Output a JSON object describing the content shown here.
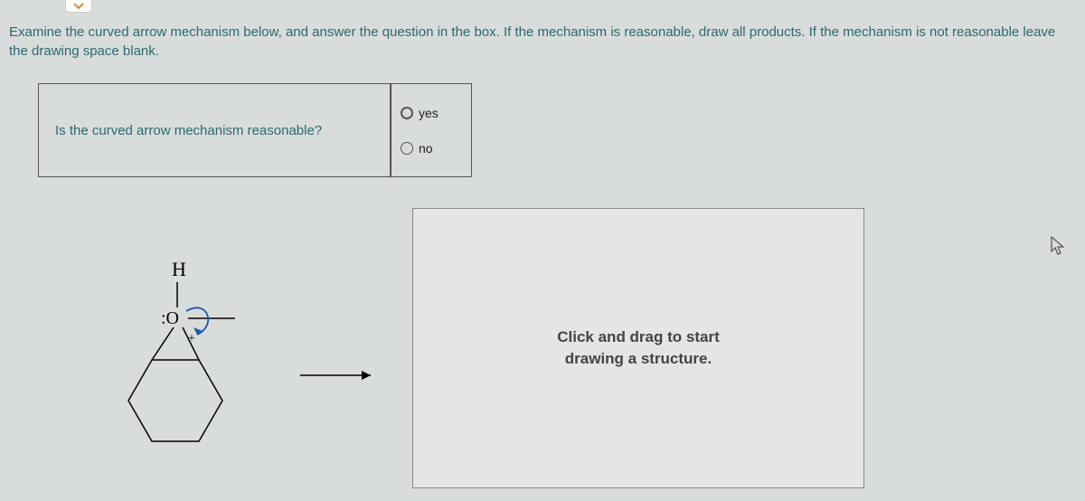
{
  "instruction": "Examine the curved arrow mechanism below, and answer the question in the box. If the mechanism is reasonable, draw all products. If the mechanism is not reasonable leave the drawing space blank.",
  "question": "Is the curved arrow mechanism reasonable?",
  "options": {
    "yes": "yes",
    "no": "no"
  },
  "molecule": {
    "h_label": "H",
    "o_label": ":O",
    "plus_label": "+"
  },
  "draw_prompt_line1": "Click and drag to start",
  "draw_prompt_line2": "drawing a structure."
}
